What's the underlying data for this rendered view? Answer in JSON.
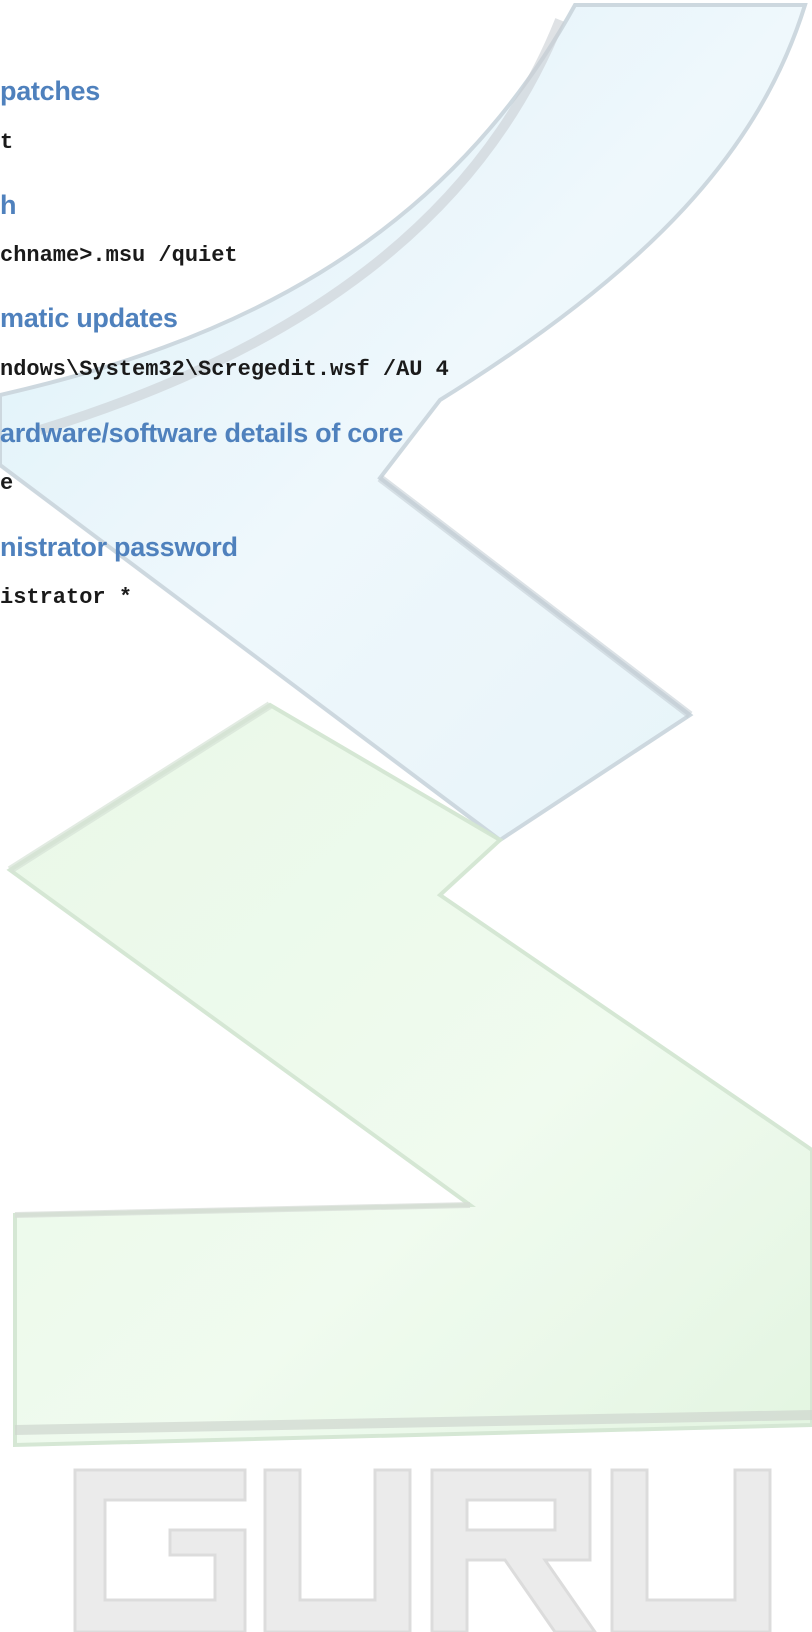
{
  "sections": [
    {
      "heading": "patches",
      "command": "t"
    },
    {
      "heading": "h",
      "command": "chname>.msu /quiet"
    },
    {
      "heading": "matic updates",
      "command": "ndows\\System32\\Scregedit.wsf /AU 4"
    },
    {
      "heading": "ardware/software details of core",
      "command": "e"
    },
    {
      "heading": "nistrator password",
      "command": "istrator *"
    }
  ],
  "watermark": {
    "logo_text": "GURU",
    "colors": {
      "upper": "#dff1f9",
      "lower": "#e6f9e6",
      "letters": "#e9e9e9"
    }
  },
  "colors": {
    "heading": "#4f81bd",
    "command": "#1a1a1a"
  }
}
